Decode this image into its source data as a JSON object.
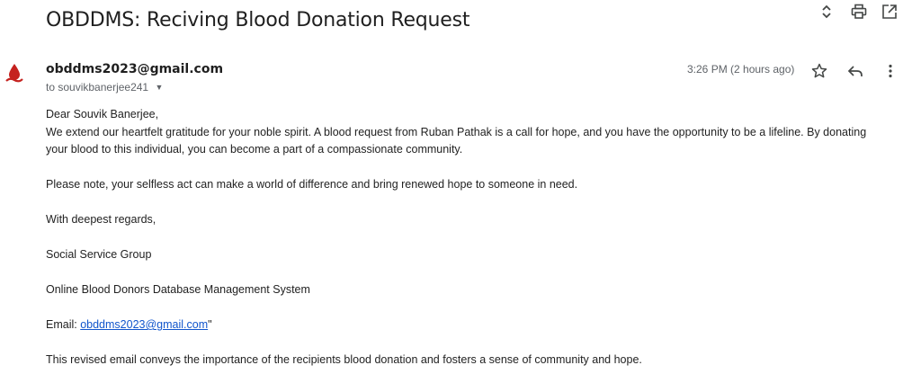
{
  "email": {
    "subject": "OBDDMS: Reciving Blood Donation Request",
    "sender": "obddms2023@gmail.com",
    "to_prefix": "to",
    "recipient": "souvikbanerjee241",
    "timestamp": "3:26 PM (2 hours ago)",
    "body": {
      "greeting": "Dear Souvik Banerjee,",
      "line1": "We extend our heartfelt gratitude for your noble spirit. A blood request from Ruban Pathak is a call for hope, and you have the opportunity to be a lifeline. By donating",
      "line2": "your blood to this individual, you can become a part of a compassionate community.",
      "para2": "Please note, your selfless act can make a world of difference and bring renewed hope to someone in need.",
      "closing": "With deepest regards,",
      "group": "Social Service Group",
      "system": "Online Blood Donors Database Management System",
      "email_label": "Email: ",
      "email_link": "obddms2023@gmail.com",
      "email_suffix": "\"",
      "footer": "This revised email conveys the importance of the recipients blood donation and fosters a sense of community and hope."
    }
  },
  "icons": {
    "toolbar": [
      "expand-collapse-icon",
      "print-icon",
      "open-in-new-window-icon"
    ],
    "header": [
      "star-icon",
      "reply-icon",
      "more-vert-icon"
    ],
    "avatar": "blood-drop-logo"
  },
  "colors": {
    "link": "#1155cc",
    "avatar": "#c5221f",
    "icon": "#444746"
  }
}
